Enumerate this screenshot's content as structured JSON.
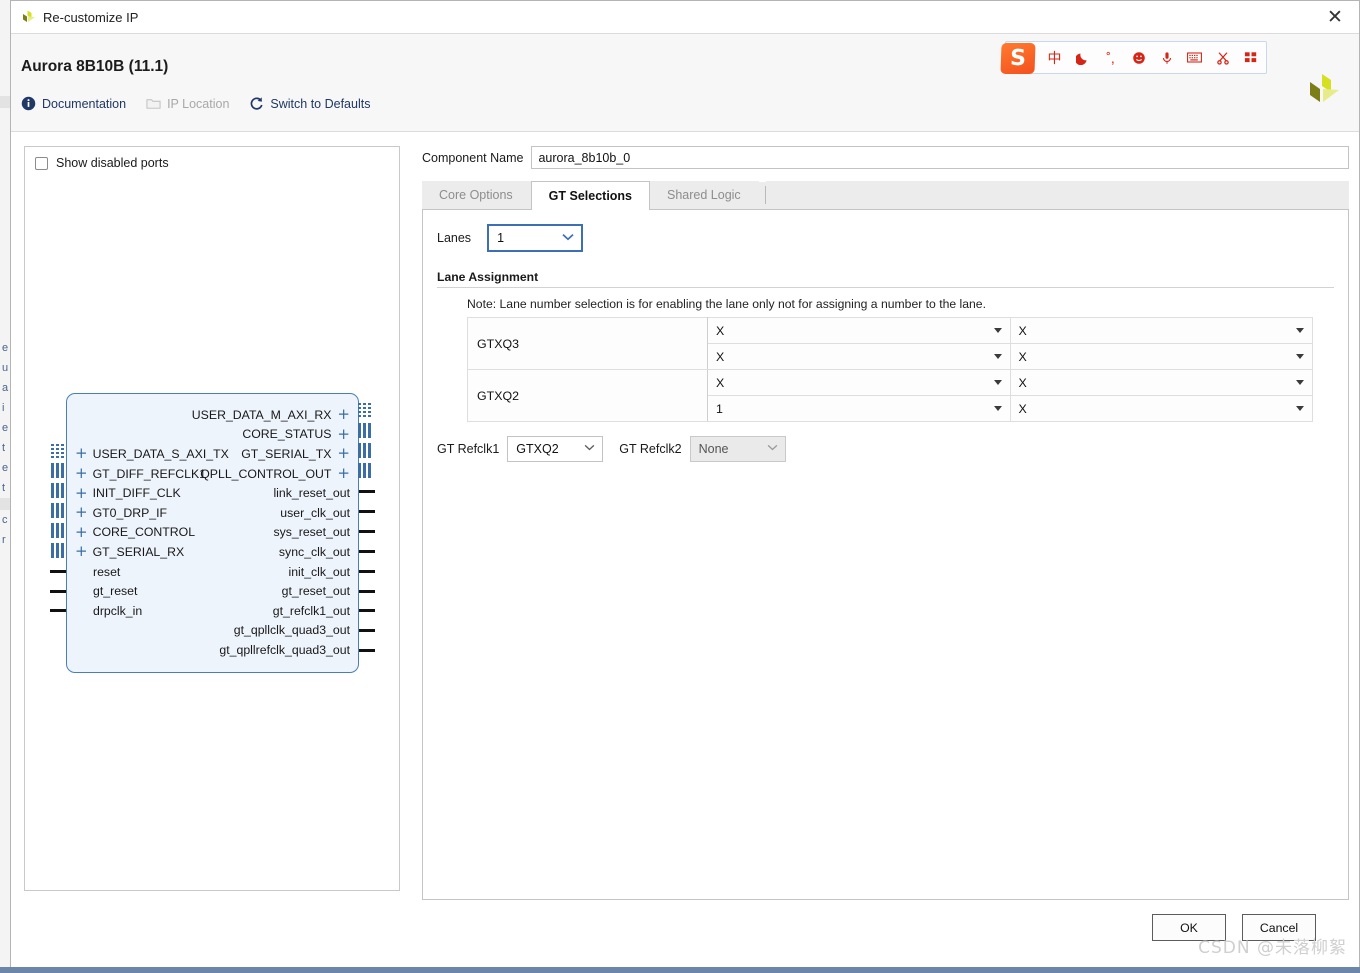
{
  "window": {
    "title": "Re-customize IP",
    "app_icon": "xilinx-logo-icon",
    "close_label": "✕"
  },
  "header": {
    "ip_title": "Aurora 8B10B (11.1)",
    "links": [
      {
        "label": "Documentation",
        "icon": "info-icon",
        "disabled": false
      },
      {
        "label": "IP Location",
        "icon": "folder-icon",
        "disabled": true
      },
      {
        "label": "Switch to Defaults",
        "icon": "refresh-icon",
        "disabled": false
      }
    ],
    "brand_logo": "xilinx-logo-icon"
  },
  "ime_toolbar": {
    "logo_text": "S",
    "logo_color": "#f4511e",
    "icon_color": "#d62516",
    "items": [
      {
        "name": "chinese-mode-icon",
        "glyph": "中"
      },
      {
        "name": "moon-icon",
        "glyph": "☽"
      },
      {
        "name": "punctuation-icon",
        "glyph": "˚,"
      },
      {
        "name": "emoji-icon",
        "glyph": "☺"
      },
      {
        "name": "microphone-icon",
        "glyph": "ඳ"
      },
      {
        "name": "keyboard-icon",
        "glyph": "⌨"
      },
      {
        "name": "scissors-icon",
        "glyph": "✂"
      },
      {
        "name": "apps-grid-icon",
        "glyph": "▒"
      }
    ]
  },
  "preview": {
    "show_disabled_ports": {
      "label": "Show disabled ports",
      "checked": false
    },
    "symbol": {
      "left_ports": [
        {
          "label": "USER_DATA_S_AXI_TX",
          "bus": true
        },
        {
          "label": "GT_DIFF_REFCLK1",
          "bus": true
        },
        {
          "label": "INIT_DIFF_CLK",
          "bus": true
        },
        {
          "label": "GT0_DRP_IF",
          "bus": true
        },
        {
          "label": "CORE_CONTROL",
          "bus": true
        },
        {
          "label": "GT_SERIAL_RX",
          "bus": true
        },
        {
          "label": "reset",
          "bus": false
        },
        {
          "label": "gt_reset",
          "bus": false
        },
        {
          "label": "drpclk_in",
          "bus": false
        }
      ],
      "right_ports": [
        {
          "label": "USER_DATA_M_AXI_RX",
          "bus": true
        },
        {
          "label": "CORE_STATUS",
          "bus": true
        },
        {
          "label": "GT_SERIAL_TX",
          "bus": true
        },
        {
          "label": "QPLL_CONTROL_OUT",
          "bus": true
        },
        {
          "label": "link_reset_out",
          "bus": false
        },
        {
          "label": "user_clk_out",
          "bus": false
        },
        {
          "label": "sys_reset_out",
          "bus": false
        },
        {
          "label": "sync_clk_out",
          "bus": false
        },
        {
          "label": "init_clk_out",
          "bus": false
        },
        {
          "label": "gt_reset_out",
          "bus": false
        },
        {
          "label": "gt_refclk1_out",
          "bus": false
        },
        {
          "label": "gt_qpllclk_quad3_out",
          "bus": false
        },
        {
          "label": "gt_qpllrefclk_quad3_out",
          "bus": false
        }
      ]
    }
  },
  "form": {
    "component_name": {
      "label": "Component Name",
      "value": "aurora_8b10b_0"
    },
    "tabs": [
      {
        "label": "Core Options",
        "active": false
      },
      {
        "label": "GT Selections",
        "active": true
      },
      {
        "label": "Shared Logic",
        "active": false
      }
    ],
    "lanes": {
      "label": "Lanes",
      "value": "1"
    },
    "lane_assignment": {
      "title": "Lane Assignment",
      "note": "Note: Lane number selection is for enabling the lane only not for assigning a number to the lane.",
      "rows": [
        {
          "quad": "GTXQ3",
          "lines": [
            {
              "col1": "X",
              "col2": "X"
            },
            {
              "col1": "X",
              "col2": "X"
            }
          ]
        },
        {
          "quad": "GTXQ2",
          "lines": [
            {
              "col1": "X",
              "col2": "X"
            },
            {
              "col1": "1",
              "col2": "X"
            }
          ]
        }
      ]
    },
    "refclk": [
      {
        "label": "GT Refclk1",
        "value": "GTXQ2",
        "disabled": false
      },
      {
        "label": "GT Refclk2",
        "value": "None",
        "disabled": true
      }
    ]
  },
  "footer": {
    "ok_label": "OK",
    "cancel_label": "Cancel",
    "watermark": "CSDN @未落柳絮"
  }
}
